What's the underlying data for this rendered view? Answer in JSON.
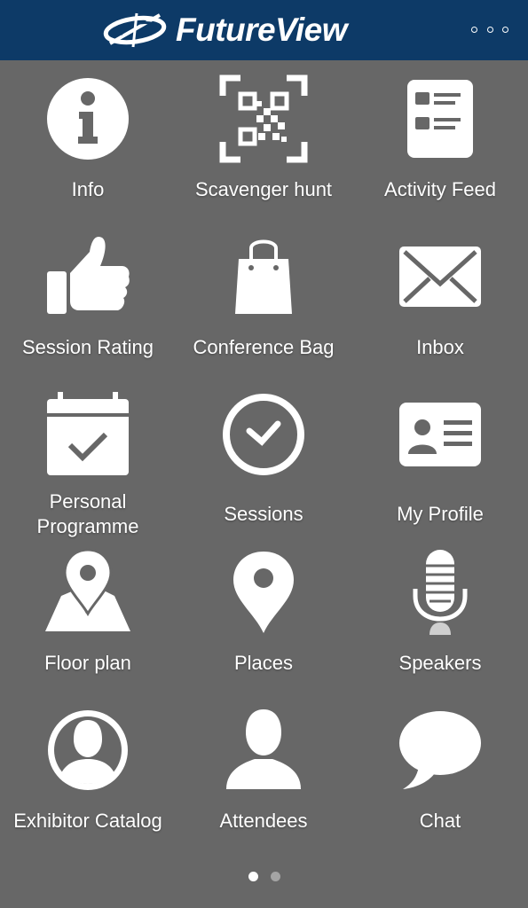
{
  "header": {
    "brand": "FutureView",
    "menu_icon": "more-horizontal-icon",
    "background": "#0d3a67"
  },
  "tiles": [
    {
      "label": "Info",
      "icon": "info-icon"
    },
    {
      "label": "Scavenger hunt",
      "icon": "qr-code-icon"
    },
    {
      "label": "Activity Feed",
      "icon": "activity-feed-icon"
    },
    {
      "label": "Session Rating",
      "icon": "thumbs-up-icon"
    },
    {
      "label": "Conference Bag",
      "icon": "shopping-bag-icon"
    },
    {
      "label": "Inbox",
      "icon": "envelope-icon"
    },
    {
      "label": "Personal Programme",
      "label_line1": "Personal",
      "label_line2": "Programme",
      "icon": "calendar-check-icon"
    },
    {
      "label": "Sessions",
      "icon": "clock-icon"
    },
    {
      "label": "My Profile",
      "icon": "id-card-icon"
    },
    {
      "label": "Floor plan",
      "icon": "map-pin-icon"
    },
    {
      "label": "Places",
      "icon": "location-pin-icon"
    },
    {
      "label": "Speakers",
      "icon": "microphone-icon"
    },
    {
      "label": "Exhibitor Catalog",
      "icon": "user-circle-icon"
    },
    {
      "label": "Attendees",
      "icon": "person-icon"
    },
    {
      "label": "Chat",
      "icon": "speech-bubble-icon"
    }
  ],
  "pager": {
    "pages": 2,
    "active_page": 1
  },
  "colors": {
    "background": "#676767",
    "icon": "#ffffff",
    "text": "#ffffff"
  }
}
